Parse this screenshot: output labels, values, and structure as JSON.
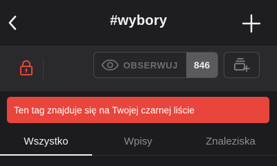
{
  "header": {
    "title": "#wybory",
    "back_icon": "chevron-left-icon",
    "add_icon": "plus-icon"
  },
  "toolbar": {
    "lock_icon": "lock-icon",
    "lock_color": "#e8453c",
    "observe": {
      "icon": "eye-icon",
      "label": "OBSERWUJ",
      "count": "846"
    },
    "stack_icon": "stack-add-icon"
  },
  "alert": {
    "text": "Ten tag znajduje się na Twojej czarnej liście",
    "color": "#e8453c"
  },
  "tabs": [
    {
      "label": "Wszystko",
      "active": true
    },
    {
      "label": "Wpisy",
      "active": false
    },
    {
      "label": "Znaleziska",
      "active": false
    }
  ]
}
